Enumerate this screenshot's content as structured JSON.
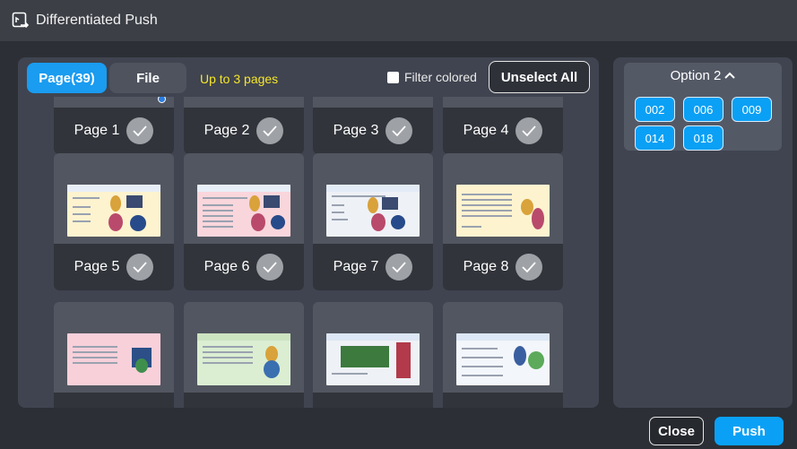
{
  "window": {
    "title": "Differentiated Push",
    "icon": "push-screen-icon"
  },
  "tabs": [
    {
      "label": "Page(39)",
      "active": true
    },
    {
      "label": "File",
      "active": false
    }
  ],
  "limit_note": "Up to 3 pages",
  "filter": {
    "label": "Filter colored",
    "checked": false
  },
  "unselect_label": "Unselect All",
  "pages": [
    {
      "label": "Page 1"
    },
    {
      "label": "Page 2"
    },
    {
      "label": "Page 3"
    },
    {
      "label": "Page 4"
    },
    {
      "label": "Page 5"
    },
    {
      "label": "Page 6"
    },
    {
      "label": "Page 7"
    },
    {
      "label": "Page 8"
    },
    {
      "label": ""
    },
    {
      "label": ""
    },
    {
      "label": ""
    },
    {
      "label": ""
    }
  ],
  "option": {
    "title": "Option 2",
    "expanded": true,
    "chips": [
      "002",
      "006",
      "009",
      "014",
      "018"
    ]
  },
  "footer": {
    "close_label": "Close",
    "push_label": "Push"
  },
  "colors": {
    "accent": "#0aa0f5",
    "note": "#f5e62a",
    "panel": "#404450"
  }
}
